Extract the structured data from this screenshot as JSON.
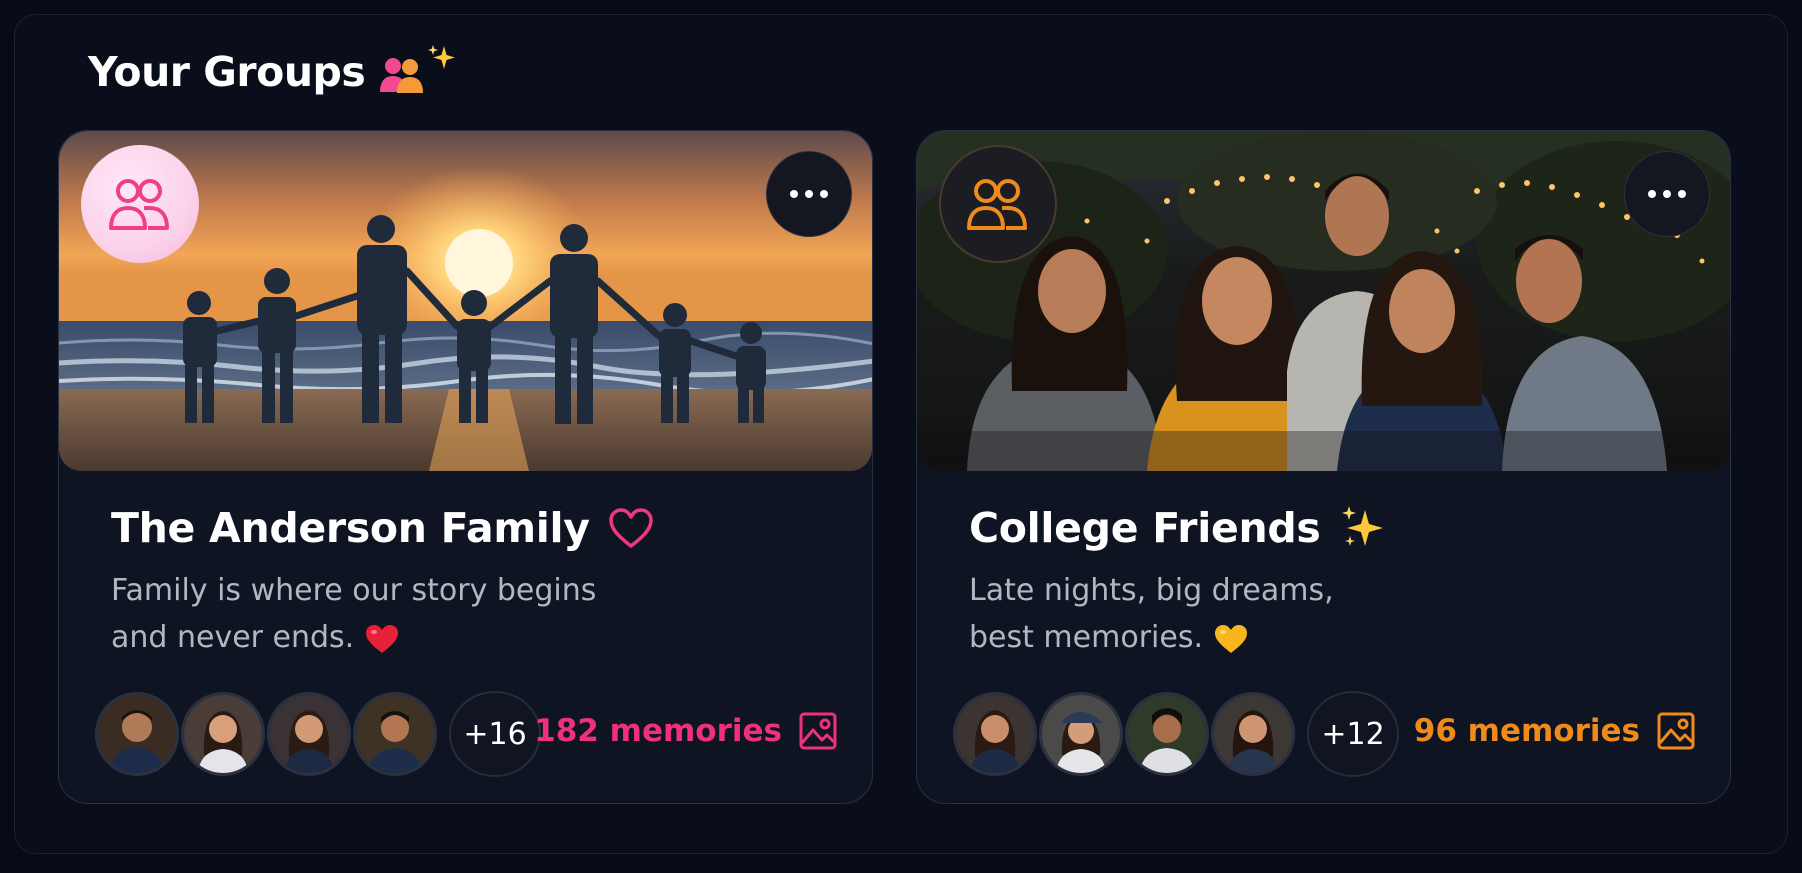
{
  "section": {
    "title": "Your Groups",
    "icons": [
      "people-icon",
      "sparkles-icon"
    ]
  },
  "groups": [
    {
      "name": "The Anderson Family",
      "title_icon": "heart-outline-icon",
      "description_line1": "Family is where our story begins",
      "description_line2": "and never ends.",
      "description_emoji": "red-heart-icon",
      "badge_icon": "people-icon",
      "accent_color": "#f0307f",
      "cover_image": "family-beach-sunset",
      "member_avatars": 4,
      "more_members": "+16",
      "memories": "182 memories",
      "memories_icon": "image-icon"
    },
    {
      "name": "College Friends",
      "title_icon": "sparkles-icon",
      "description_line1": "Late nights, big dreams,",
      "description_line2": "best memories.",
      "description_emoji": "yellow-heart-icon",
      "badge_icon": "people-icon",
      "accent_color": "#f08a1a",
      "cover_image": "friends-evening-gathering",
      "member_avatars": 4,
      "more_members": "+12",
      "memories": "96 memories",
      "memories_icon": "image-icon"
    }
  ]
}
